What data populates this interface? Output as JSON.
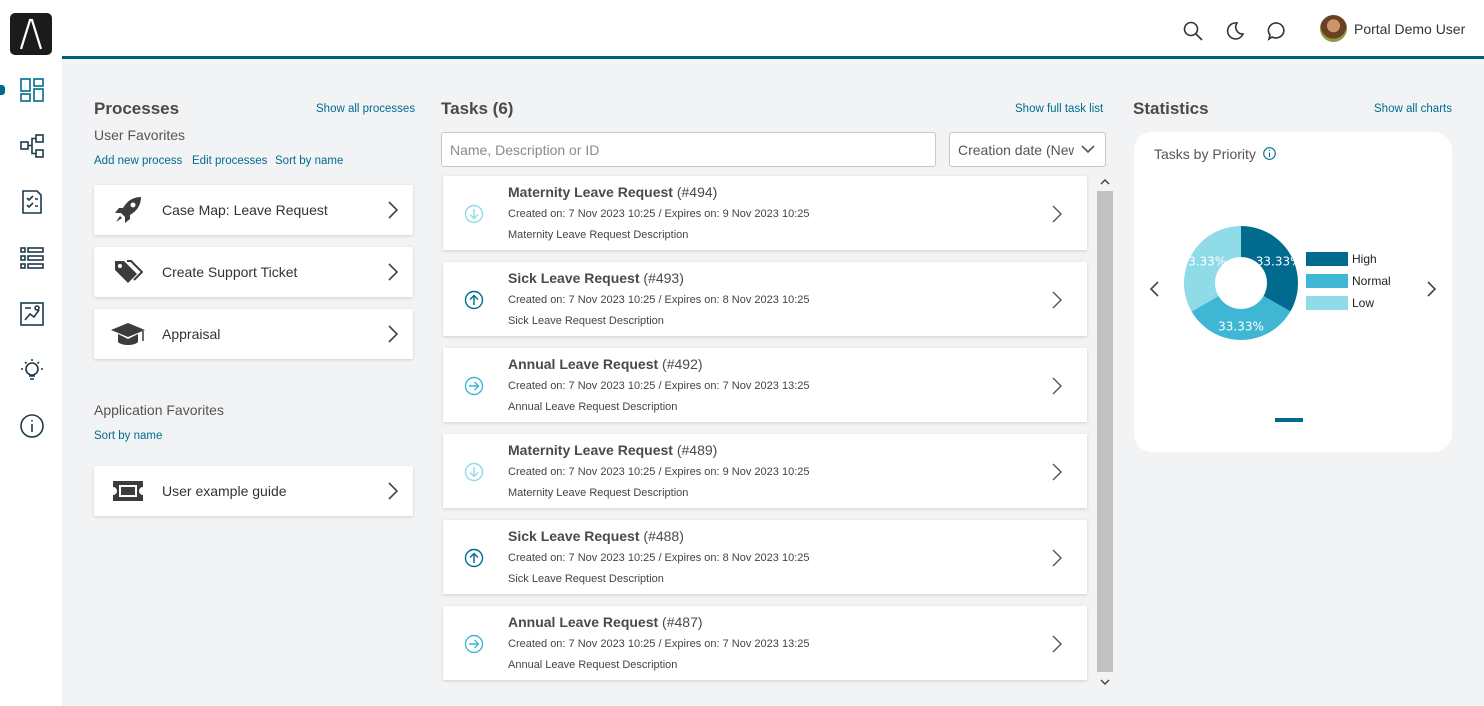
{
  "header": {
    "user_name": "Portal Demo User",
    "icons": [
      "search-icon",
      "moon-icon",
      "chat-icon"
    ]
  },
  "sidebar": {
    "items": [
      "dashboard-icon",
      "processes-icon",
      "tasks-icon",
      "cases-icon",
      "statistics-icon",
      "lightbulb-icon",
      "info-icon"
    ],
    "active": "dashboard"
  },
  "processes": {
    "title": "Processes",
    "show_all": "Show all processes",
    "user_favorites": "User Favorites",
    "add_new": "Add new process",
    "edit": "Edit processes",
    "sort": "Sort by name",
    "items": [
      {
        "label": "Case Map: Leave Request",
        "icon": "rocket-icon"
      },
      {
        "label": "Create Support Ticket",
        "icon": "tags-icon"
      },
      {
        "label": "Appraisal",
        "icon": "graduation-cap-icon"
      }
    ],
    "app_favorites": "Application Favorites",
    "app_sort": "Sort by name",
    "apps": [
      {
        "label": "User example guide",
        "icon": "ticket-icon"
      }
    ]
  },
  "tasks": {
    "title": "Tasks (6)",
    "show_full": "Show full task list",
    "search_placeholder": "Name, Description or ID",
    "sort_value": "Creation date (Newest first)",
    "items": [
      {
        "name": "Maternity Leave Request",
        "id": "(#494)",
        "meta": "Created on: 7 Nov 2023 10:25 / Expires on: 9 Nov 2023 10:25",
        "desc": "Maternity Leave Request Description",
        "priority": "low"
      },
      {
        "name": "Sick Leave Request",
        "id": "(#493)",
        "meta": "Created on: 7 Nov 2023 10:25 / Expires on: 8 Nov 2023 10:25",
        "desc": "Sick Leave Request Description",
        "priority": "high"
      },
      {
        "name": "Annual Leave Request",
        "id": "(#492)",
        "meta": "Created on: 7 Nov 2023 10:25 / Expires on: 7 Nov 2023 13:25",
        "desc": "Annual Leave Request Description",
        "priority": "normal"
      },
      {
        "name": "Maternity Leave Request",
        "id": "(#489)",
        "meta": "Created on: 7 Nov 2023 10:25 / Expires on: 9 Nov 2023 10:25",
        "desc": "Maternity Leave Request Description",
        "priority": "low"
      },
      {
        "name": "Sick Leave Request",
        "id": "(#488)",
        "meta": "Created on: 7 Nov 2023 10:25 / Expires on: 8 Nov 2023 10:25",
        "desc": "Sick Leave Request Description",
        "priority": "high"
      },
      {
        "name": "Annual Leave Request",
        "id": "(#487)",
        "meta": "Created on: 7 Nov 2023 10:25 / Expires on: 7 Nov 2023 13:25",
        "desc": "Annual Leave Request Description",
        "priority": "normal"
      }
    ]
  },
  "statistics": {
    "title": "Statistics",
    "show_all": "Show all charts",
    "chart_title": "Tasks by Priority"
  },
  "chart_data": {
    "type": "pie",
    "title": "Tasks by Priority",
    "categories": [
      "High",
      "Normal",
      "Low"
    ],
    "values": [
      33.33,
      33.33,
      33.33
    ],
    "labels": [
      "33.33%",
      "33.33%",
      "33.33%"
    ],
    "colors": [
      "#006b8f",
      "#3fb6d3",
      "#8fdbe8"
    ],
    "legend": "right"
  },
  "colors": {
    "accent": "#006b8f",
    "high": "#006b8f",
    "normal": "#3fb6d3",
    "low": "#8fdbe8"
  }
}
